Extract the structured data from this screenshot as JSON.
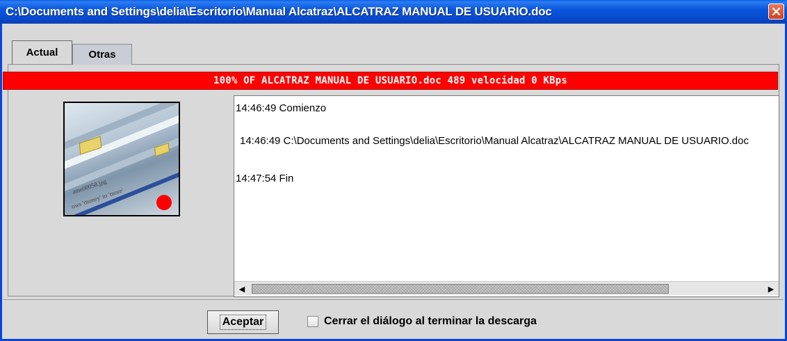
{
  "window": {
    "title": "C:\\Documents and Settings\\delia\\Escritorio\\Manual Alcatraz\\ALCATRAZ  MANUAL DE USUARIO.doc",
    "close_icon": "close-icon"
  },
  "tabs": [
    {
      "label": "Actual",
      "selected": true
    },
    {
      "label": "Otras",
      "selected": false
    }
  ],
  "progress": {
    "text": "100% OF ALCATRAZ  MANUAL DE USUARIO.doc 489 velocidad  0 KBps",
    "percent": 100,
    "color": "#ff0000"
  },
  "thumbnail": {
    "icon": "download-image-icon",
    "texts": [
      "ame00058.jpg",
      "ows 'money' to 'more'"
    ],
    "status_dot_color": "#ff0000"
  },
  "log": {
    "lines": [
      "14:46:49 Comienzo",
      " 14:46:49 C:\\Documents and Settings\\delia\\Escritorio\\Manual Alcatraz\\ALCATRAZ  MANUAL DE USUARIO.doc",
      "14:47:54 Fin"
    ]
  },
  "footer": {
    "accept_label": "Aceptar",
    "checkbox_label": "Cerrar el diálogo al terminar la descarga",
    "checkbox_checked": false
  }
}
